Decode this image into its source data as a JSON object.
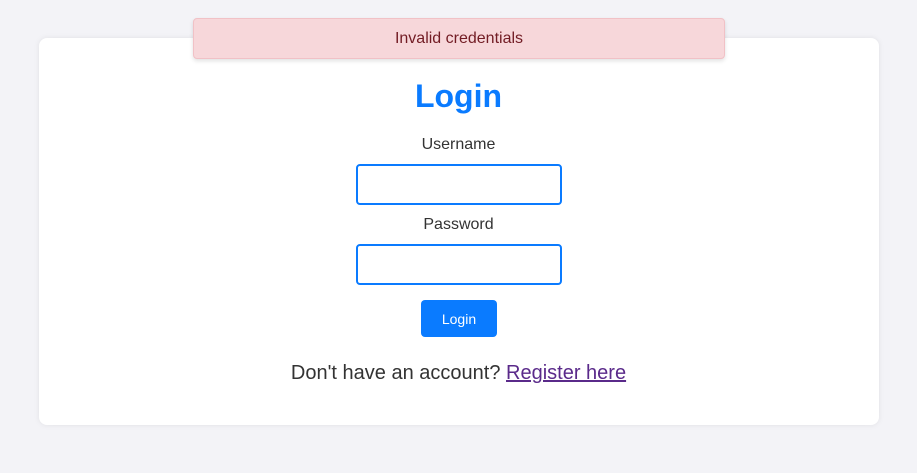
{
  "alert": {
    "message": "Invalid credentials"
  },
  "login_form": {
    "title": "Login",
    "username_label": "Username",
    "username_value": "",
    "password_label": "Password",
    "password_value": "",
    "submit_label": "Login"
  },
  "footer": {
    "prompt": "Don't have an account?",
    "register_link": "Register here"
  },
  "colors": {
    "accent": "#0a7bff",
    "alert_bg": "#f7d7da",
    "alert_text": "#721c24",
    "link_visited": "#5a2a8a"
  }
}
